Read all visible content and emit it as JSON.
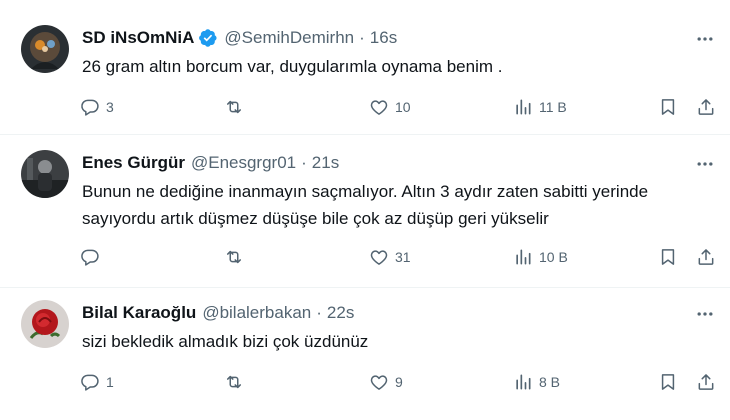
{
  "tweets": [
    {
      "name": "SD iNsOmNiA",
      "verified": true,
      "handle": "@SemihDemirhn",
      "sep": "·",
      "time": "16s",
      "text": "26 gram altın borcum var, duygularımla oynama benim .",
      "replies": "3",
      "retweets": "",
      "likes": "10",
      "views": "11 B"
    },
    {
      "name": "Enes Gürgür",
      "verified": false,
      "handle": "@Enesgrgr01",
      "sep": "·",
      "time": "21s",
      "text": "Bunun ne dediğine inanmayın saçmalıyor. Altın 3 aydır zaten sabitti yerinde sayıyordu artık düşmez düşüşe bile çok az düşüp geri yükselir",
      "replies": "",
      "retweets": "",
      "likes": "31",
      "views": "10 B"
    },
    {
      "name": "Bilal Karaoğlu",
      "verified": false,
      "handle": "@bilalerbakan",
      "sep": "·",
      "time": "22s",
      "text": "sizi bekledik almadık bizi çok üzdünüz",
      "replies": "1",
      "retweets": "",
      "likes": "9",
      "views": "8 B"
    }
  ],
  "icons": {
    "reply": "reply-icon",
    "retweet": "retweet-icon",
    "like": "like-icon",
    "views": "views-icon",
    "bookmark": "bookmark-icon",
    "share": "share-icon",
    "more": "more-icon",
    "verified": "verified-badge-icon"
  },
  "colors": {
    "text": "#0f1419",
    "secondary": "#536471",
    "verified": "#1d9bf0",
    "divider": "#eff3f4"
  }
}
